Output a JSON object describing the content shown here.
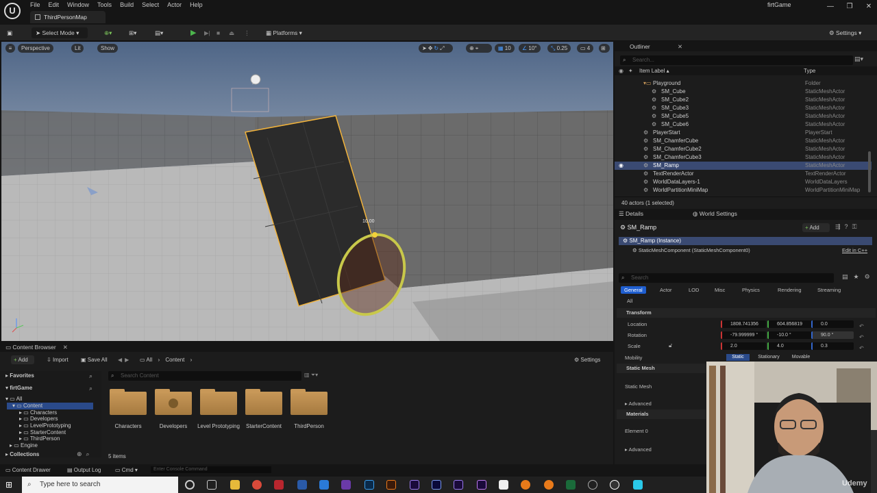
{
  "app": {
    "project_name": "firtGame",
    "map_tab": "ThirdPersonMap"
  },
  "menu": [
    "File",
    "Edit",
    "Window",
    "Tools",
    "Build",
    "Select",
    "Actor",
    "Help"
  ],
  "toolbar": {
    "select_mode": "Select Mode",
    "platforms": "Platforms",
    "settings": "Settings"
  },
  "viewport": {
    "perspective": "Perspective",
    "lit": "Lit",
    "show": "Show",
    "grid_snap": "10",
    "rot_snap": "10°",
    "scale_snap": "0.25",
    "cam_speed": "4",
    "gizmo_value": "10.00"
  },
  "outliner": {
    "title": "Outliner",
    "search_placeholder": "Search...",
    "col_label": "Item Label ▴",
    "col_type": "Type",
    "items": [
      {
        "label": "Playground",
        "type": "Folder",
        "indent": 3
      },
      {
        "label": "SM_Cube",
        "type": "StaticMeshActor",
        "indent": 4
      },
      {
        "label": "SM_Cube2",
        "type": "StaticMeshActor",
        "indent": 4
      },
      {
        "label": "SM_Cube3",
        "type": "StaticMeshActor",
        "indent": 4
      },
      {
        "label": "SM_Cube5",
        "type": "StaticMeshActor",
        "indent": 4
      },
      {
        "label": "SM_Cube6",
        "type": "StaticMeshActor",
        "indent": 4
      },
      {
        "label": "PlayerStart",
        "type": "PlayerStart",
        "indent": 3
      },
      {
        "label": "SM_ChamferCube",
        "type": "StaticMeshActor",
        "indent": 3
      },
      {
        "label": "SM_ChamferCube2",
        "type": "StaticMeshActor",
        "indent": 3
      },
      {
        "label": "SM_ChamferCube3",
        "type": "StaticMeshActor",
        "indent": 3
      },
      {
        "label": "SM_Ramp",
        "type": "StaticMeshActor",
        "indent": 3,
        "selected": true
      },
      {
        "label": "TextRenderActor",
        "type": "TextRenderActor",
        "indent": 3
      },
      {
        "label": "WorldDataLayers-1",
        "type": "WorldDataLayers",
        "indent": 3
      },
      {
        "label": "WorldPartitionMiniMap",
        "type": "WorldPartitionMiniMap",
        "indent": 3
      }
    ],
    "footer": "40 actors (1 selected)"
  },
  "details": {
    "tab_details": "Details",
    "tab_world": "World Settings",
    "object_name": "SM_Ramp",
    "add_label": "Add",
    "instance_label": "SM_Ramp (Instance)",
    "component_label": "StaticMeshComponent (StaticMeshComponent0)",
    "edit_cpp": "Edit in C++",
    "search_placeholder": "Search",
    "filter_tabs": [
      "General",
      "Actor",
      "LOD",
      "Misc",
      "Physics",
      "Rendering",
      "Streaming"
    ],
    "all_label": "All",
    "transform_header": "Transform",
    "location_label": "Location",
    "location": [
      "1808.741356",
      "604.856819",
      "0.0"
    ],
    "rotation_label": "Rotation",
    "rotation": [
      "-79.999999 °",
      "-10.0 °",
      "90.0 °"
    ],
    "scale_label": "Scale",
    "scale": [
      "2.0",
      "4.0",
      "0.3"
    ],
    "mobility_label": "Mobility",
    "mobility_options": [
      "Static",
      "Stationary",
      "Movable"
    ],
    "static_mesh_header": "Static Mesh",
    "static_mesh_label": "Static Mesh",
    "advanced_label": "Advanced",
    "materials_header": "Materials",
    "element0_label": "Element 0"
  },
  "content_browser": {
    "tab": "Content Browser",
    "add": "Add",
    "import": "Import",
    "save_all": "Save All",
    "path": [
      "All",
      "Content"
    ],
    "settings": "Settings",
    "favorites": "Favorites",
    "project": "firtGame",
    "tree": [
      "All",
      "Content",
      "Characters",
      "Developers",
      "LevelPrototyping",
      "StarterContent",
      "ThirdPerson",
      "Engine"
    ],
    "collections": "Collections",
    "search_placeholder": "Search Content",
    "folders": [
      "Characters",
      "Developers",
      "Level Prototyping",
      "StarterContent",
      "ThirdPerson"
    ],
    "item_count": "5 items"
  },
  "statusbar": {
    "drawer": "Content Drawer",
    "log": "Output Log",
    "cmd": "Cmd",
    "console_placeholder": "Enter Console Command"
  },
  "taskbar": {
    "search_placeholder": "Type here to search"
  },
  "webcam": {
    "watermark": "Udemy"
  }
}
